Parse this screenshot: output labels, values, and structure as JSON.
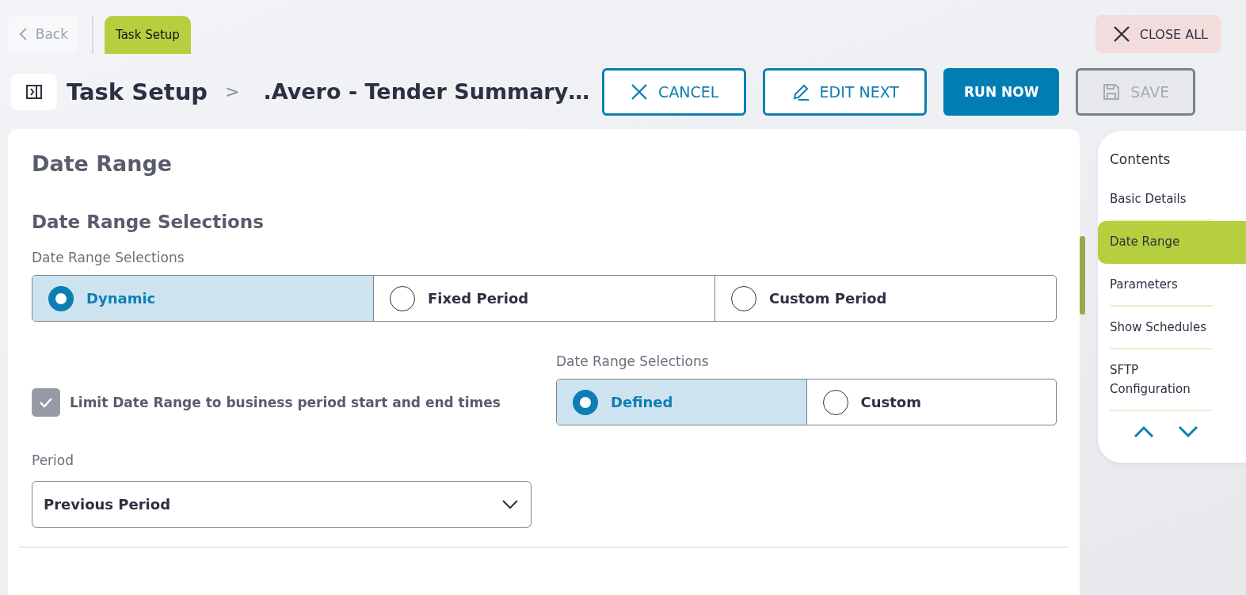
{
  "top_bar": {
    "back_label": "Back",
    "tabs": [
      {
        "label": "Task Setup",
        "selected": true
      }
    ],
    "close_all_label": "CLOSE ALL"
  },
  "header": {
    "title": "Task Setup",
    "separator": ">",
    "record_title": ".Avero - Tender Summary…",
    "buttons": [
      {
        "kind": "cancel",
        "label": "CANCEL",
        "disabled": false
      },
      {
        "kind": "edit",
        "label": "EDIT NEXT",
        "disabled": false
      },
      {
        "kind": "primary",
        "label": "RUN NOW",
        "disabled": false
      },
      {
        "kind": "save",
        "label": "SAVE",
        "disabled": true
      }
    ]
  },
  "form": {
    "title": "Date Range",
    "section_title": "Date Range Selections",
    "range_label": "Date Range Selections",
    "range_options": [
      {
        "label": "Dynamic",
        "selected": true
      },
      {
        "label": "Fixed Period",
        "selected": false
      },
      {
        "label": "Custom Period",
        "selected": false
      }
    ],
    "limit_checkbox": {
      "label": "Limit Date Range to business period start and end times",
      "checked": true
    },
    "selection_label": "Date Range Selections",
    "selection_options": [
      {
        "label": "Defined",
        "selected": true
      },
      {
        "label": "Custom",
        "selected": false
      }
    ],
    "period": {
      "label": "Period",
      "value": "Previous Period"
    }
  },
  "contents": {
    "title": "Contents",
    "items": [
      {
        "label": "Basic Details",
        "selected": false
      },
      {
        "label": "Date Range",
        "selected": true
      },
      {
        "label": "Parameters",
        "selected": false
      },
      {
        "label": "Show Schedules",
        "selected": false
      },
      {
        "label": "SFTP Configuration",
        "selected": false
      }
    ]
  }
}
